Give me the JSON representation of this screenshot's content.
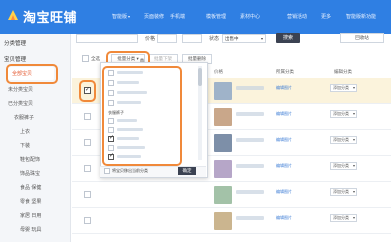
{
  "header": {
    "logo_text": "淘宝旺铺",
    "nav": [
      {
        "label": "智能版",
        "has_arrow": true
      },
      {
        "label": "页面装修"
      },
      {
        "label": "手机端"
      },
      {
        "label": "模板管理"
      },
      {
        "label": "素材中心"
      },
      {
        "label": "营销活动"
      },
      {
        "label": "更多"
      },
      {
        "label": "智能版新功能"
      }
    ]
  },
  "sidebar": {
    "group1": "分类管理",
    "group2": "宝贝管理",
    "active": "全部宝贝",
    "items": [
      "未分类宝贝",
      "已分类宝贝",
      "衣服裤子",
      "上衣",
      "下装",
      "鞋包配饰",
      "饰品珠宝",
      "食品 保健",
      "零食 坚果",
      "家居 日用",
      "母婴 玩具"
    ]
  },
  "filters": {
    "price_label": "价格",
    "status_label": "状态",
    "status_value": "出售中",
    "search_button": "搜索",
    "trash_button": "回收站"
  },
  "toolbar": {
    "select_all": "全选",
    "batch_category": "批量分类",
    "batch_remove": "批量下架",
    "batch_delete": "批量删除"
  },
  "table": {
    "headers": [
      "宝贝信息",
      "价格",
      "所属分类",
      "编辑分类"
    ],
    "rows": [
      {
        "checked": true,
        "link": "编辑图片",
        "cat": "添加分类"
      },
      {
        "checked": false,
        "link": "编辑图片",
        "cat": "添加分类"
      },
      {
        "checked": false,
        "link": "编辑图片",
        "cat": "添加分类"
      },
      {
        "checked": false,
        "link": "编辑图片",
        "cat": "添加分类"
      },
      {
        "checked": false,
        "link": "编辑图片",
        "cat": "添加分类"
      },
      {
        "checked": false,
        "link": "编辑图片",
        "cat": "添加分类"
      }
    ]
  },
  "dropdown": {
    "section_label": "衣服裤子",
    "items": [
      {
        "checked": false
      },
      {
        "checked": false
      },
      {
        "checked": false
      },
      {
        "checked": false
      },
      {
        "checked": false
      },
      {
        "checked": false
      },
      {
        "checked": true
      },
      {
        "checked": false
      },
      {
        "checked": true
      },
      {
        "checked": false
      },
      {
        "checked": false
      }
    ],
    "footer_hint": "将宝贝移出当前分类",
    "confirm": "确定"
  },
  "colors": {
    "header_bg": "#2f7fe3",
    "highlight": "#f0893a",
    "active_text": "#e4572e",
    "dark_button": "#3b4252"
  }
}
